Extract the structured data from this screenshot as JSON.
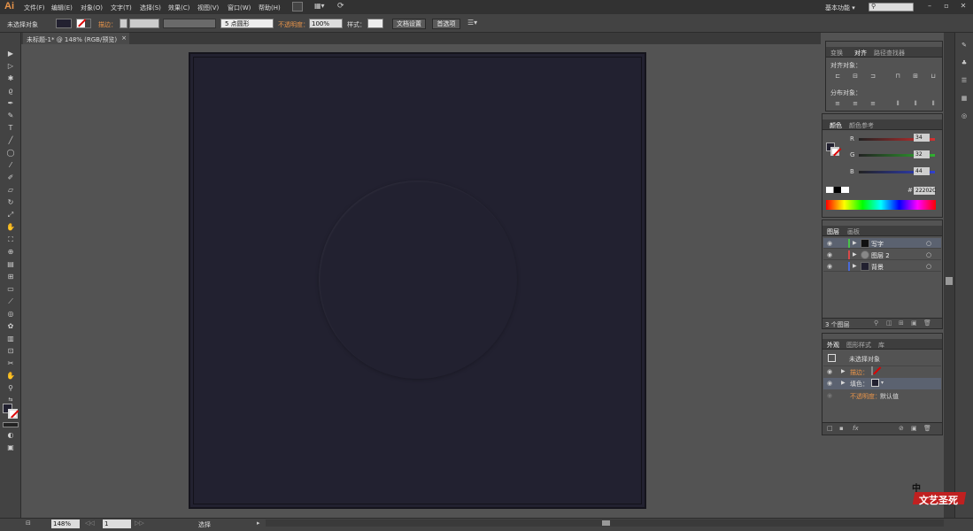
{
  "app": {
    "logo": "Ai"
  },
  "menu": [
    "文件(F)",
    "编辑(E)",
    "对象(O)",
    "文字(T)",
    "选择(S)",
    "效果(C)",
    "视图(V)",
    "窗口(W)",
    "帮助(H)"
  ],
  "workspace": {
    "label": "基本功能",
    "dropdown": "▾",
    "search_placeholder": ""
  },
  "control": {
    "selection": "未选择对象",
    "stroke_label": "描边：",
    "stroke_weight": "",
    "brush": "5 点圆形",
    "opacity_label": "不透明度：",
    "opacity_value": "100%",
    "style_label": "样式：",
    "doc_setup": "文档设置",
    "prefs": "首选项"
  },
  "document": {
    "tab_title": "未标题-1* @ 148% (RGB/预览)",
    "close": "×"
  },
  "status": {
    "zoom": "148%",
    "artboard": "1",
    "tool": "选择"
  },
  "panels": {
    "align": {
      "tabs": [
        "变换",
        "对齐",
        "路径查找器"
      ],
      "active": "对齐",
      "align_objects": "对齐对象：",
      "distribute_objects": "分布对象："
    },
    "color": {
      "tabs": [
        "颜色",
        "颜色参考"
      ],
      "channels": [
        {
          "label": "R",
          "value": "34",
          "color": "#d43030"
        },
        {
          "label": "G",
          "value": "32",
          "color": "#30b030"
        },
        {
          "label": "B",
          "value": "44",
          "color": "#3040d0"
        }
      ],
      "hex_label": "#",
      "hex_value": "22202C"
    },
    "layers": {
      "tabs": [
        "图层",
        "画板"
      ],
      "items": [
        {
          "name": "写字",
          "color": "#4ac24a"
        },
        {
          "name": "图层 2",
          "color": "#d84a4a"
        },
        {
          "name": "背景",
          "color": "#4a6ad8"
        }
      ],
      "count": "3 个图层"
    },
    "appearance": {
      "tabs": [
        "外观",
        "图形样式",
        "库"
      ],
      "title": "未选择对象",
      "stroke_label": "描边：",
      "fill_label": "填色：",
      "opacity_label": "不透明度：",
      "opacity_value": "默认值"
    }
  },
  "watermark": {
    "line1": "中",
    "line2": "文艺圣死"
  }
}
